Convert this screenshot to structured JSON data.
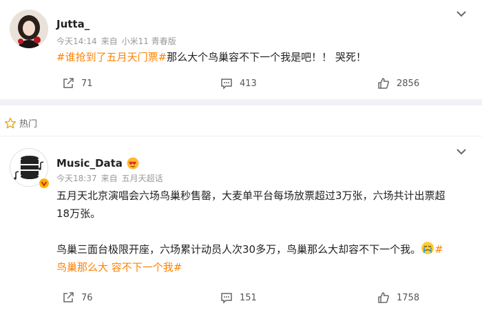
{
  "post1": {
    "username": "Jutta_",
    "time": "今天14:14",
    "source_prefix": "来自",
    "source": "小米11 青春版",
    "hashtag": "#谁抢到了五月天门票#",
    "text": "那么大个鸟巢容不下一个我是吧！！ 哭死！",
    "reposts": "71",
    "comments": "413",
    "likes": "2856"
  },
  "hot_section": {
    "label": "热门"
  },
  "post2": {
    "username": "Music_Data",
    "time": "今天18:37",
    "source_prefix": "来自",
    "source": "五月天超话",
    "para1_line1": "五月天北京演唱会六场鸟巢秒售罄，大麦单平台每场放票超过3万张，六场共计出票超",
    "para1_line2": "18万张。",
    "para2_text": "鸟巢三面台极限开座，六场累计动员人次30多万，鸟巢那么大却容不下一个我。",
    "hashtag_part1": "#",
    "hashtag_part2": "鸟巢那么大 容不下一个我#",
    "reposts": "76",
    "comments": "151",
    "likes": "1758"
  },
  "colors": {
    "accent": "#ff8200",
    "background": "#f1f2f5",
    "card": "#ffffff"
  }
}
